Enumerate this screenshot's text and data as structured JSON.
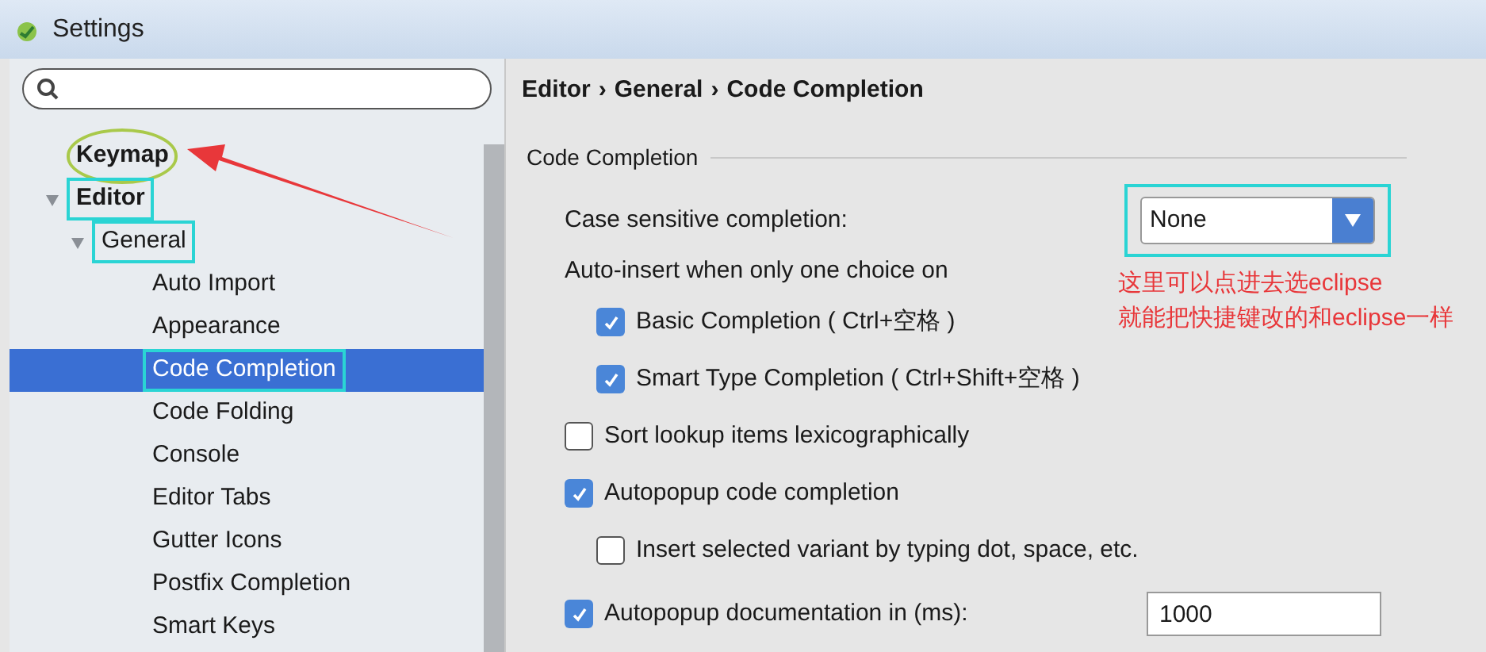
{
  "window": {
    "title": "Settings"
  },
  "tree": [
    {
      "label": "Keymap",
      "bold": true,
      "selected": false,
      "boxed": false,
      "circled": true
    },
    {
      "label": "Editor",
      "bold": true,
      "selected": false,
      "boxed": true,
      "circled": false,
      "expanded": true,
      "children": [
        {
          "label": "General",
          "bold": false,
          "selected": false,
          "boxed": true,
          "circled": false,
          "expanded": true,
          "children": [
            {
              "label": "Auto Import",
              "bold": false,
              "selected": false,
              "boxed": false,
              "circled": false
            },
            {
              "label": "Appearance",
              "bold": false,
              "selected": false,
              "boxed": false,
              "circled": false
            },
            {
              "label": "Code Completion",
              "bold": false,
              "selected": true,
              "boxed": true,
              "circled": false
            },
            {
              "label": "Code Folding",
              "bold": false,
              "selected": false,
              "boxed": false,
              "circled": false
            },
            {
              "label": "Console",
              "bold": false,
              "selected": false,
              "boxed": false,
              "circled": false
            },
            {
              "label": "Editor Tabs",
              "bold": false,
              "selected": false,
              "boxed": false,
              "circled": false
            },
            {
              "label": "Gutter Icons",
              "bold": false,
              "selected": false,
              "boxed": false,
              "circled": false
            },
            {
              "label": "Postfix Completion",
              "bold": false,
              "selected": false,
              "boxed": false,
              "circled": false
            },
            {
              "label": "Smart Keys",
              "bold": false,
              "selected": false,
              "boxed": false,
              "circled": false
            }
          ]
        }
      ]
    }
  ],
  "breadcrumb": [
    "Editor",
    "General",
    "Code Completion"
  ],
  "breadcrumb_separator": "›",
  "section": {
    "title": "Code Completion"
  },
  "options": [
    {
      "kind": "select",
      "label": "Case sensitive completion:",
      "value": "None",
      "boxed": true
    },
    {
      "kind": "label",
      "label": "Auto-insert when only one choice on",
      "children": [
        {
          "kind": "checkbox",
          "label": "Basic Completion ( Ctrl+空格 )",
          "checked": true
        },
        {
          "kind": "checkbox",
          "label": "Smart Type Completion ( Ctrl+Shift+空格 )",
          "checked": true
        }
      ]
    },
    {
      "kind": "checkbox",
      "label": "Sort lookup items lexicographically",
      "checked": false
    },
    {
      "kind": "checkbox",
      "label": "Autopopup code completion",
      "checked": true,
      "children": [
        {
          "kind": "checkbox",
          "label": "Insert selected variant by typing dot, space, etc.",
          "checked": false
        }
      ]
    },
    {
      "kind": "checkbox_input",
      "label": "Autopopup documentation in (ms):",
      "checked": true,
      "value": "1000"
    }
  ],
  "annotation": {
    "lines": [
      "这里可以点进去选eclipse",
      "就能把快捷键改的和eclipse一样"
    ]
  }
}
